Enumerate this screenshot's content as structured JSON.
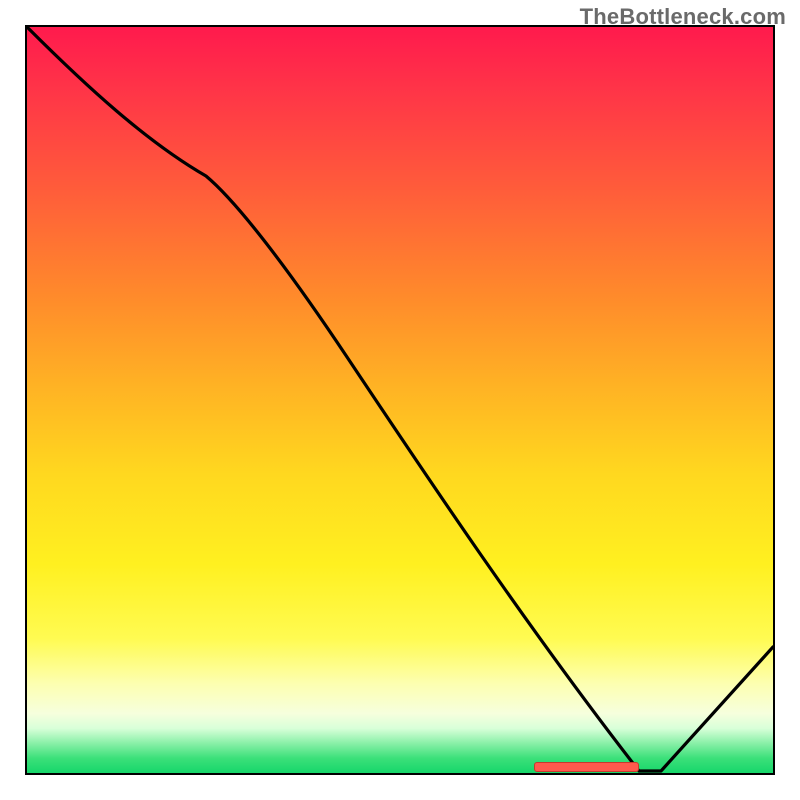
{
  "watermark": "TheBottleneck.com",
  "chart_data": {
    "type": "line",
    "title": "",
    "xlabel": "",
    "ylabel": "",
    "x": [
      0,
      24,
      82,
      85,
      100
    ],
    "y": [
      100,
      80,
      0,
      0,
      17
    ],
    "xlim": [
      0,
      100
    ],
    "ylim": [
      0,
      100
    ],
    "marker": {
      "x_start": 68,
      "x_end": 82,
      "y": 0
    },
    "annotations": [
      "TheBottleneck.com"
    ],
    "background": "vertical-gradient red→orange→yellow→pale→green",
    "grid": false,
    "legend": false
  },
  "colors": {
    "curve": "#000000",
    "border": "#000000",
    "marker_fill": "#ff5a4d",
    "marker_border": "#c63a2e",
    "watermark": "#6a6a6a",
    "gradient_top": "#ff1a4d",
    "gradient_bottom": "#16d66a"
  }
}
